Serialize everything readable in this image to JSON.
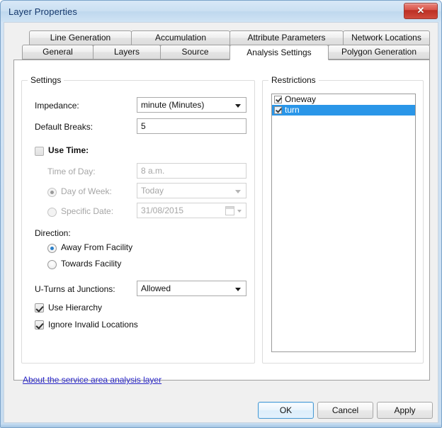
{
  "window": {
    "title": "Layer Properties",
    "close_label": "✕"
  },
  "tabs": {
    "row1": [
      {
        "label": "Line Generation",
        "active": false
      },
      {
        "label": "Accumulation",
        "active": false
      },
      {
        "label": "Attribute Parameters",
        "active": false
      },
      {
        "label": "Network Locations",
        "active": false
      }
    ],
    "row2": [
      {
        "label": "General",
        "active": false
      },
      {
        "label": "Layers",
        "active": false
      },
      {
        "label": "Source",
        "active": false
      },
      {
        "label": "Analysis Settings",
        "active": true
      },
      {
        "label": "Polygon Generation",
        "active": false
      }
    ]
  },
  "settings": {
    "group_label": "Settings",
    "impedance_label": "Impedance:",
    "impedance_value": "minute (Minutes)",
    "default_breaks_label": "Default Breaks:",
    "default_breaks_value": "5",
    "use_time_label": "Use Time:",
    "use_time_checked": false,
    "time_of_day_label": "Time of Day:",
    "time_of_day_value": "8 a.m.",
    "day_of_week_label": "Day of Week:",
    "day_of_week_value": "Today",
    "day_of_week_selected": true,
    "specific_date_label": "Specific Date:",
    "specific_date_value": "31/08/2015",
    "specific_date_selected": false,
    "direction_label": "Direction:",
    "direction_away_label": "Away From Facility",
    "direction_towards_label": "Towards Facility",
    "direction_selected": "away",
    "uturns_label": "U-Turns at Junctions:",
    "uturns_value": "Allowed",
    "use_hierarchy_label": "Use Hierarchy",
    "use_hierarchy_checked": true,
    "ignore_invalid_label": "Ignore Invalid Locations",
    "ignore_invalid_checked": true
  },
  "restrictions": {
    "group_label": "Restrictions",
    "items": [
      {
        "label": "Oneway",
        "checked": true,
        "selected": false
      },
      {
        "label": "turn",
        "checked": true,
        "selected": true
      }
    ]
  },
  "about_link": "About the service area analysis layer",
  "buttons": {
    "ok": "OK",
    "cancel": "Cancel",
    "apply": "Apply"
  },
  "colors": {
    "selection_blue": "#2a96e8",
    "link_blue": "#2b28c8",
    "close_red": "#bc2f24",
    "radio_dot": "#2a7fc9"
  }
}
